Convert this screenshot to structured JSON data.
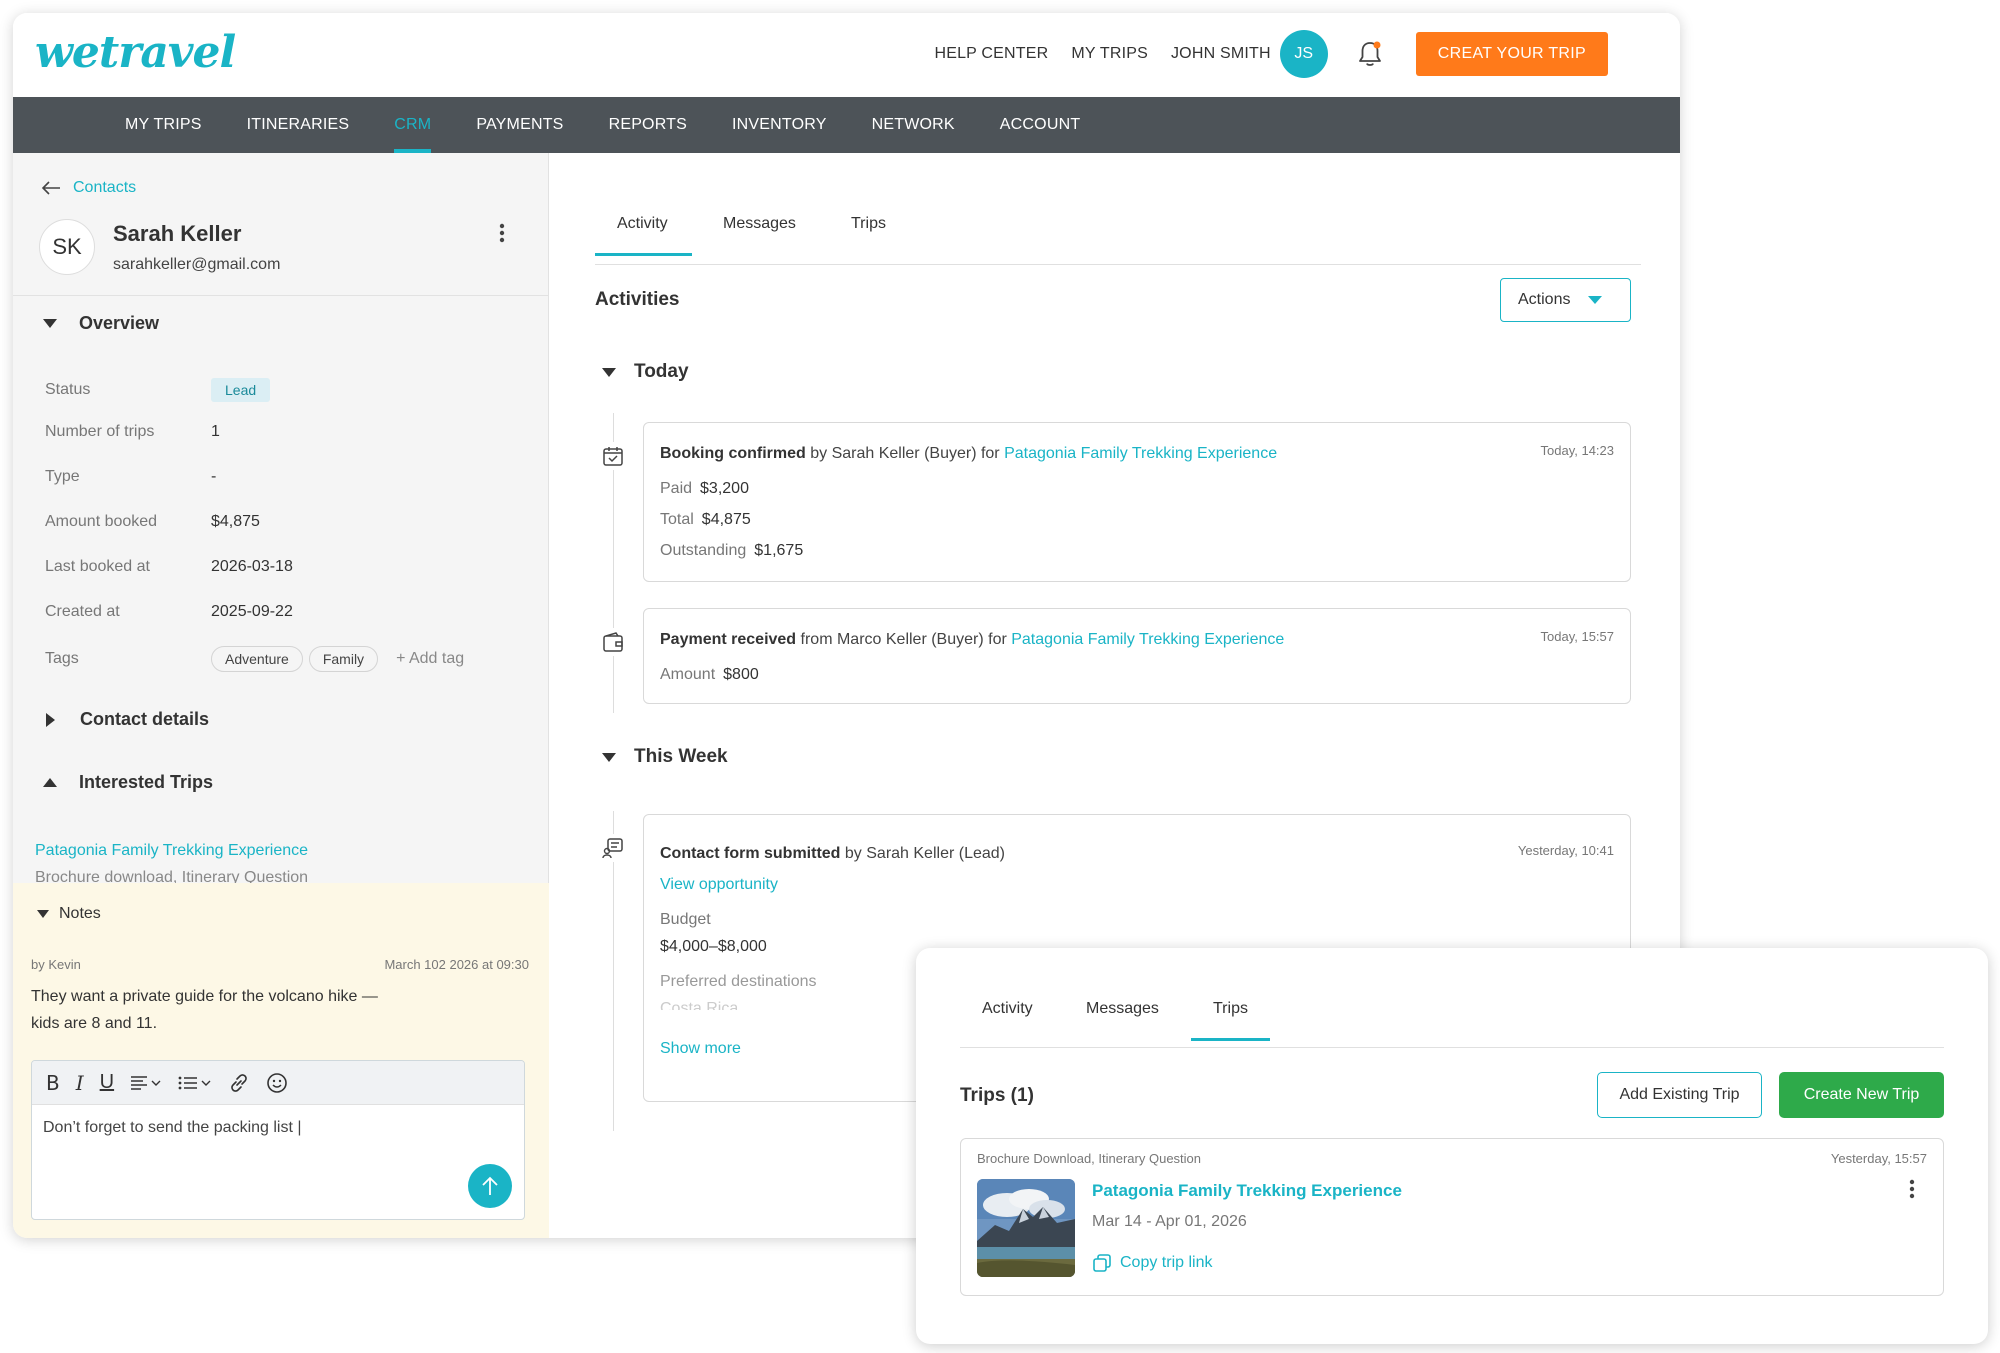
{
  "brand": {
    "logo": "wetravel",
    "accent": "#1ab4c6",
    "cta_color": "#ff7a1a",
    "nav_bg": "#4d5358",
    "green": "#2eaa4a"
  },
  "header": {
    "links": [
      "HELP CENTER",
      "MY TRIPS",
      "JOHN SMITH"
    ],
    "avatar": "JS",
    "bell_icon": "bell-icon",
    "cta": "CREAT YOUR TRIP"
  },
  "nav": [
    "MY TRIPS",
    "ITINERARIES",
    "CRM",
    "PAYMENTS",
    "REPORTS",
    "INVENTORY",
    "NETWORK",
    "ACCOUNT"
  ],
  "contact": {
    "back": "Contacts",
    "initials": "SK",
    "name": "Sarah Keller",
    "email": "sarahkeller@gmail.com"
  },
  "overview": {
    "title": "Overview",
    "rows": [
      {
        "label": "Status",
        "value": "Lead"
      },
      {
        "label": "Number of trips",
        "value": "1"
      },
      {
        "label": "Type",
        "value": "-"
      },
      {
        "label": "Amount booked",
        "value": "$4,875"
      },
      {
        "label": "Last booked at",
        "value": "2026-03-18"
      },
      {
        "label": "Created at",
        "value": "2025-09-22"
      },
      {
        "label": "Tags",
        "value": ""
      }
    ],
    "tags": [
      "Adventure",
      "Family"
    ],
    "add_tag": "+ Add tag"
  },
  "contact_details": {
    "title": "Contact details"
  },
  "interested_trips": {
    "title": "Interested Trips",
    "trip": "Patagonia Family Trekking Experience",
    "sub": "Brochure download, Itinerary Question"
  },
  "notes": {
    "title": "Notes",
    "by": "by Kevin",
    "date": "March 102 2026 at 09:30",
    "line1": "They want a private guide for the volcano hike —",
    "line2": "kids are 8 and 11.",
    "draft": "Don’t forget to send the packing list |"
  },
  "main": {
    "tabs": [
      "Activity",
      "Messages",
      "Trips"
    ],
    "title": "Activities",
    "actions": "Actions",
    "groups": [
      "Today",
      "This Week"
    ],
    "booking": {
      "title": "Booking confirmed",
      "by": " by Sarah Keller (Buyer) for ",
      "trip": "Patagonia Family Trekking Experience",
      "time": "Today, 14:23",
      "paid_label": "Paid",
      "paid": "$3,200",
      "total_label": "Total",
      "total": "$4,875",
      "out_label": "Outstanding",
      "out": "$1,675"
    },
    "payment": {
      "title": "Payment received",
      "by": " from Marco Keller (Buyer) for ",
      "trip": "Patagonia Family Trekking Experience",
      "time": "Today, 15:57",
      "amount_label": "Amount",
      "amount": "$800"
    },
    "form": {
      "title": "Contact form submitted",
      "by": " by Sarah Keller (Lead)",
      "time": "Yesterday, 10:41",
      "view": "View opportunity",
      "budget_label": "Budget",
      "budget": "$4,000–$8,000",
      "pref_label": "Preferred destinations",
      "pref": "Costa Rica",
      "show_more": "Show more"
    }
  },
  "trips_panel": {
    "tabs": [
      "Activity",
      "Messages",
      "Trips"
    ],
    "title": "Trips (1)",
    "add_existing": "Add Existing Trip",
    "create_new": "Create New Trip",
    "card": {
      "sub": "Brochure Download, Itinerary Question",
      "time": "Yesterday, 15:57",
      "name": "Patagonia Family Trekking Experience",
      "dates": "Mar 14 - Apr 01, 2026",
      "copy": "Copy trip link"
    }
  }
}
